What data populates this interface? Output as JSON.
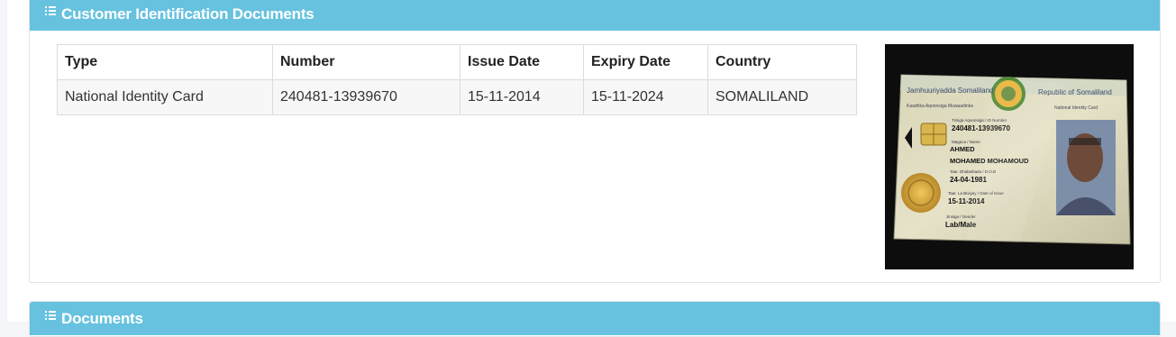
{
  "identification_panel": {
    "title": "Customer Identification Documents",
    "table": {
      "headers": [
        "Type",
        "Number",
        "Issue Date",
        "Expiry Date",
        "Country"
      ],
      "rows": [
        [
          "National Identity Card",
          "240481-13939670",
          "15-11-2014",
          "15-11-2024",
          "SOMALILAND"
        ]
      ]
    },
    "id_image": {
      "card_lines": {
        "issuer_left": "Jamhuuriyadda Somaliland",
        "issuer_right": "Republic of Somaliland",
        "subtitle_left": "Kaadhka Aqoonsiga Muwaadinka",
        "subtitle_right": "National Identity Card",
        "id_label": "Tirsiga Aqoonsiga / ID Number",
        "id_number": "240481-13939670",
        "name_label": "Magaca / Name",
        "first_name": "AHMED",
        "full_name": "MOHAMED MOHAMOUD",
        "dob_label": "Taar. Dhalashada / D.O.B",
        "dob": "24-04-1981",
        "issue_label": "Taar. La Bixiyey / Date of Issue",
        "issue_date": "15-11-2014",
        "gender_label": "Jinsiga / Gender",
        "gender": "Lab/Male"
      }
    }
  },
  "documents_panel": {
    "title": "Documents"
  },
  "colors": {
    "panel_heading": "#67c2df",
    "heading_text": "#ffffff"
  }
}
